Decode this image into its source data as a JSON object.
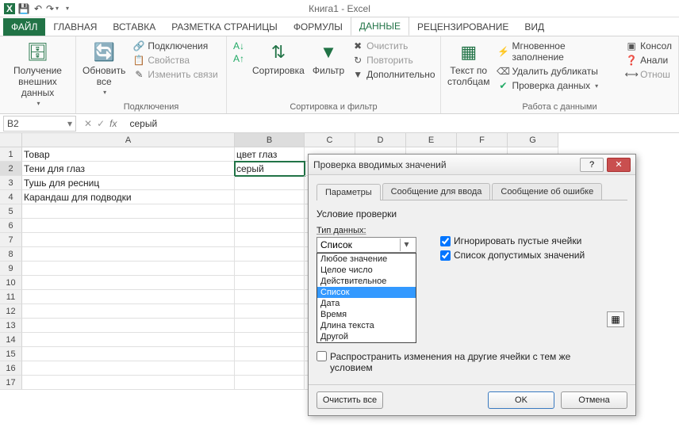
{
  "titlebar": {
    "app_title": "Книга1 - Excel"
  },
  "tabs": {
    "file": "ФАЙЛ",
    "items": [
      "ГЛАВНАЯ",
      "ВСТАВКА",
      "РАЗМЕТКА СТРАНИЦЫ",
      "ФОРМУЛЫ",
      "ДАННЫЕ",
      "РЕЦЕНЗИРОВАНИЕ",
      "ВИД"
    ],
    "active_index": 4
  },
  "ribbon": {
    "g1": {
      "btn": "Получение\nвнешних данных"
    },
    "g2": {
      "refresh": "Обновить\nвсе",
      "connections": "Подключения",
      "properties": "Свойства",
      "editlinks": "Изменить связи",
      "group_label": "Подключения"
    },
    "g3": {
      "sort": "Сортировка",
      "filter": "Фильтр",
      "clear": "Очистить",
      "reapply": "Повторить",
      "advanced": "Дополнительно",
      "group_label": "Сортировка и фильтр"
    },
    "g4": {
      "texttocol": "Текст по\nстолбцам",
      "flashfill": "Мгновенное заполнение",
      "remdup": "Удалить дубликаты",
      "datavalid": "Проверка данных",
      "consolidate": "Консол",
      "whatif": "Анали",
      "relations": "Отнош",
      "group_label": "Работа с данными"
    }
  },
  "namebox": {
    "ref": "B2"
  },
  "formula": {
    "value": "серый"
  },
  "columns": [
    "A",
    "B",
    "C",
    "D",
    "E",
    "F",
    "G"
  ],
  "rows": [
    {
      "A": "Товар",
      "B": "цвет глаз"
    },
    {
      "A": "Тени для глаз",
      "B": "серый"
    },
    {
      "A": "Тушь для ресниц",
      "B": ""
    },
    {
      "A": "Карандаш для подводки",
      "B": ""
    },
    {
      "A": "",
      "B": ""
    },
    {
      "A": "",
      "B": ""
    },
    {
      "A": "",
      "B": ""
    },
    {
      "A": "",
      "B": ""
    },
    {
      "A": "",
      "B": ""
    },
    {
      "A": "",
      "B": ""
    },
    {
      "A": "",
      "B": ""
    },
    {
      "A": "",
      "B": ""
    },
    {
      "A": "",
      "B": ""
    },
    {
      "A": "",
      "B": ""
    },
    {
      "A": "",
      "B": ""
    },
    {
      "A": "",
      "B": ""
    },
    {
      "A": "",
      "B": ""
    }
  ],
  "dialog": {
    "title": "Проверка вводимых значений",
    "tabs": [
      "Параметры",
      "Сообщение для ввода",
      "Сообщение об ошибке"
    ],
    "section": "Условие проверки",
    "type_label": "Тип данных:",
    "type_value": "Список",
    "type_options": [
      "Любое значение",
      "Целое число",
      "Действительное",
      "Список",
      "Дата",
      "Время",
      "Длина текста",
      "Другой"
    ],
    "ignore_blank": "Игнорировать пустые ячейки",
    "incell_dd": "Список допустимых значений",
    "propagate": "Распространить изменения на другие ячейки с тем же условием",
    "clear": "Очистить все",
    "ok": "OK",
    "cancel": "Отмена"
  }
}
